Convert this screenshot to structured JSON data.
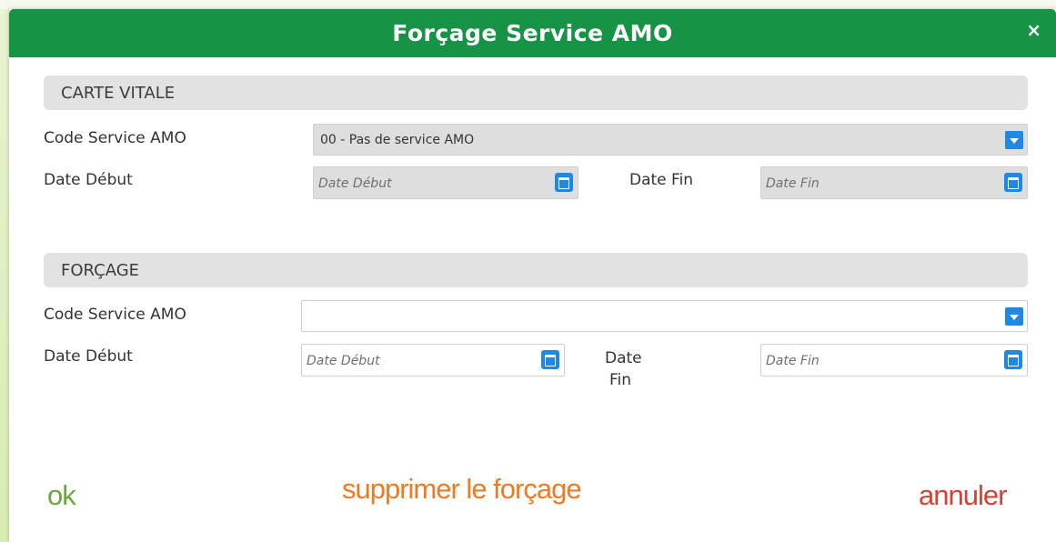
{
  "dialog": {
    "title": "Forçage Service AMO",
    "close_glyph": "×"
  },
  "carte_vitale": {
    "header": "CARTE VITALE",
    "code_label": "Code Service AMO",
    "code_value": "00 - Pas de service AMO",
    "date_debut_label": "Date Début",
    "date_debut_placeholder": "Date Début",
    "date_fin_label": "Date Fin",
    "date_fin_placeholder": "Date Fin"
  },
  "forcage": {
    "header": "FORÇAGE",
    "code_label": "Code Service AMO",
    "code_value": "",
    "date_debut_label": "Date Début",
    "date_debut_placeholder": "Date Début",
    "date_fin_label_line1": "Date",
    "date_fin_label_line2": "Fin",
    "date_fin_placeholder": "Date Fin"
  },
  "footer": {
    "ok_label": "ok",
    "supprimer_label": "supprimer le forçage",
    "annuler_label": "annuler"
  },
  "colors": {
    "title_bar": "#179345",
    "ok": "#6aa83a",
    "supprimer": "#ef7a22",
    "annuler": "#d94034",
    "icon_blue": "#1e88e5"
  },
  "icons": {
    "dropdown": "chevron-down-icon",
    "calendar": "calendar-icon",
    "close": "close-icon"
  }
}
